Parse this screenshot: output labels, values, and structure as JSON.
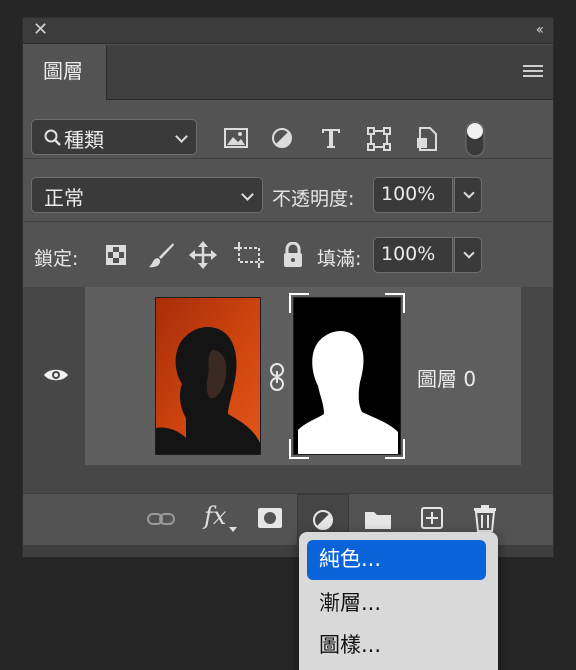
{
  "panel": {
    "close_glyph": "✕",
    "collapse_glyph": "‹‹",
    "tab_label": "圖層"
  },
  "filter": {
    "kind_label": "種類",
    "icons": [
      "image-filter-icon",
      "adjustment-filter-icon",
      "type-filter-icon",
      "shape-filter-icon",
      "smart-object-filter-icon",
      "filter-toggle"
    ]
  },
  "blend": {
    "mode": "正常",
    "opacity_label": "不透明度:",
    "opacity_value": "100%"
  },
  "lock": {
    "label": "鎖定:",
    "fill_label": "填滿:",
    "fill_value": "100%"
  },
  "layer": {
    "name": "圖層 0",
    "visible": true
  },
  "bottom_bar": {
    "fx_label": "fx"
  },
  "menu": {
    "items": [
      "純色...",
      "漸層...",
      "圖樣..."
    ],
    "selected_index": 0
  },
  "colors": {
    "accent": "#0a63d8",
    "photo_bg": "#c8400f"
  }
}
